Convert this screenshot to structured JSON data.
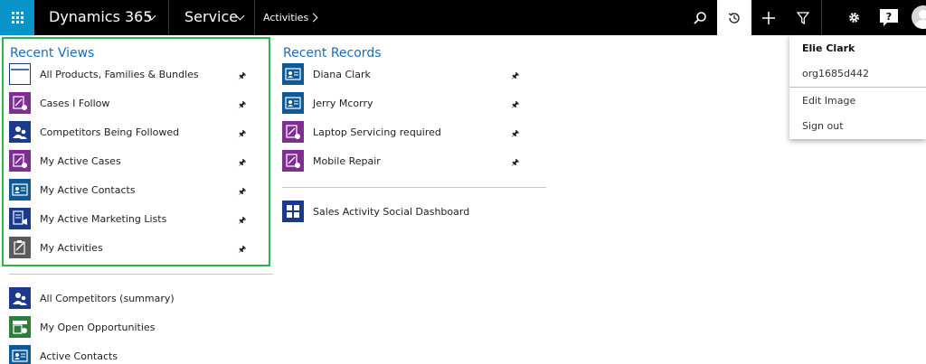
{
  "nav": {
    "app_title": "Dynamics 365",
    "area_title": "Service",
    "entity": "Activities"
  },
  "recent_views": {
    "title": "Recent Views",
    "items": [
      {
        "label": "All Products, Families & Bundles",
        "icon": "window-icon",
        "color": "#ffffff"
      },
      {
        "label": "Cases I Follow",
        "icon": "case-icon",
        "color": "#7f2f93"
      },
      {
        "label": "Competitors Being Followed",
        "icon": "competitor-icon",
        "color": "#1a3a8e"
      },
      {
        "label": "My Active Cases",
        "icon": "case-icon",
        "color": "#7f2f93"
      },
      {
        "label": "My Active Contacts",
        "icon": "contact-card-icon",
        "color": "#0f5a96"
      },
      {
        "label": "My Active Marketing Lists",
        "icon": "marketing-list-icon",
        "color": "#1a3a8e"
      },
      {
        "label": "My Activities",
        "icon": "activity-icon",
        "color": "#5a5a5a"
      }
    ],
    "more_items": [
      {
        "label": "All Competitors (summary)",
        "icon": "competitor-icon",
        "color": "#1a3a8e"
      },
      {
        "label": "My Open Opportunities",
        "icon": "opportunity-icon",
        "color": "#2f7d3a"
      },
      {
        "label": "Active Contacts",
        "icon": "contact-card-icon",
        "color": "#0f5a96"
      }
    ]
  },
  "recent_records": {
    "title": "Recent Records",
    "items": [
      {
        "label": "Diana Clark",
        "icon": "contact-card-icon",
        "color": "#0f5a96"
      },
      {
        "label": "Jerry Mcorry",
        "icon": "contact-card-icon",
        "color": "#0f5a96"
      },
      {
        "label": "Laptop Servicing required",
        "icon": "case-icon",
        "color": "#7f2f93"
      },
      {
        "label": "Mobile Repair",
        "icon": "case-icon",
        "color": "#7f2f93"
      }
    ],
    "dashboard": {
      "label": "Sales Activity Social Dashboard",
      "icon": "dashboard-icon",
      "color": "#1a3a8e"
    }
  },
  "user_menu": {
    "name": "Elie Clark",
    "org": "org1685d442",
    "edit_image": "Edit Image",
    "sign_out": "Sign out"
  },
  "colors": {
    "accent_blue": "#1e6bb8",
    "waffle": "#0b94c9",
    "highlight_border": "#2fb24a"
  }
}
